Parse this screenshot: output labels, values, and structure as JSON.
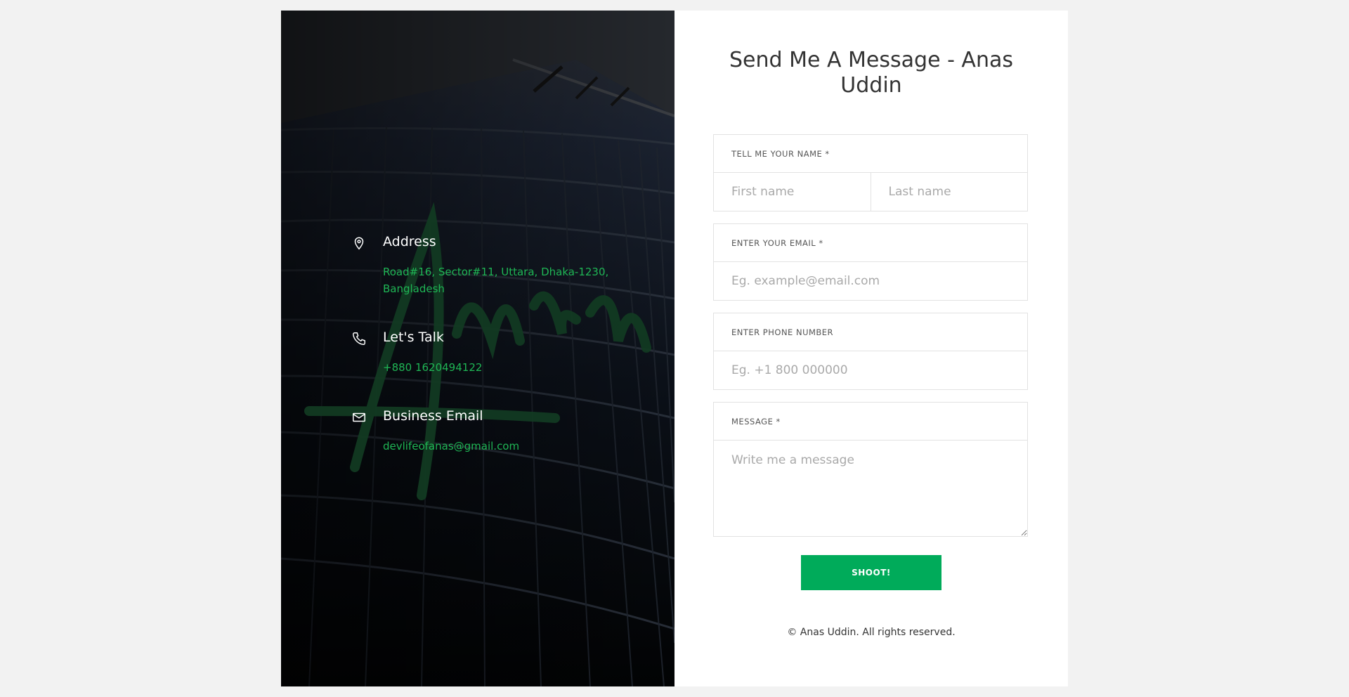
{
  "contact": {
    "address_title": "Address",
    "address_text": "Road#16, Sector#11, Uttara, Dhaka-1230, Bangladesh",
    "talk_title": "Let's Talk",
    "talk_text": "+880 1620494122",
    "email_title": "Business Email",
    "email_text": "devlifeofanas@gmail.com",
    "accent_color": "#1fb655"
  },
  "watermark": "Anas",
  "form": {
    "heading": "Send Me A Message - Anas Uddin",
    "name_label": "TELL ME YOUR NAME *",
    "first_name_placeholder": "First name",
    "last_name_placeholder": "Last name",
    "email_label": "ENTER YOUR EMAIL *",
    "email_placeholder": "Eg. example@email.com",
    "phone_label": "ENTER PHONE NUMBER",
    "phone_placeholder": "Eg. +1 800 000000",
    "message_label": "MESSAGE *",
    "message_placeholder": "Write me a message",
    "submit_label": "SHOOT!",
    "submit_color": "#00ab5a"
  },
  "footer": {
    "copyright": "© Anas Uddin. All rights reserved."
  },
  "icons": {
    "address": "map-pin-icon",
    "talk": "phone-icon",
    "email": "envelope-icon"
  }
}
